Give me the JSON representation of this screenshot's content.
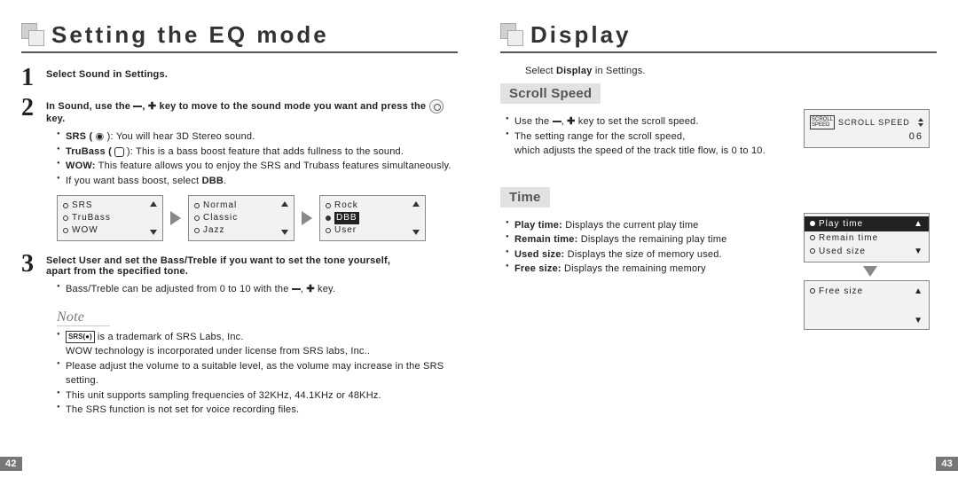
{
  "left": {
    "title": "Setting the EQ mode",
    "step1": "Select Sound in Settings.",
    "step2_a": "In Sound, use the ",
    "step2_b": " key to move to the sound mode you want and press the ",
    "step2_c": " key.",
    "bullets2": {
      "srs_label": "SRS ( ",
      "srs_text": " ): You will hear 3D Stereo sound.",
      "tru_label": "TruBass ( ",
      "tru_text": " ): This is a bass boost feature that adds fullness to the sound.",
      "wow_label": "WOW:",
      "wow_text": " This feature allows you to enjoy the SRS and Trubass features simultaneously.",
      "dbb": "If you want bass boost, select ",
      "dbb_b": "DBB"
    },
    "eq_box1": {
      "r1": "SRS",
      "r2": "TruBass",
      "r3": "WOW"
    },
    "eq_box2": {
      "r1": "Normal",
      "r2": "Classic",
      "r3": "Jazz"
    },
    "eq_box3": {
      "r1": "Rock",
      "r2": "DBB",
      "r3": "User"
    },
    "step3_a": "Select User and set the Bass/Treble if you want to set the tone yourself,",
    "step3_b": "apart from the specified tone.",
    "step3_bullet": "Bass/Treble can be adjusted from 0 to 10 with the ",
    "step3_bullet_end": " key.",
    "note_label": "Note",
    "notes": {
      "n1a": " is a trademark of SRS Labs, Inc.",
      "n1b": "WOW technology is incorporated under license from SRS labs, Inc..",
      "n2": "Please adjust the volume to a suitable level, as the volume may increase in the SRS setting.",
      "n3": "This unit supports sampling frequencies of 32KHz, 44.1KHz or 48KHz.",
      "n4": "The SRS function is not set for voice recording files."
    },
    "pagenum": "42"
  },
  "right": {
    "title": "Display",
    "intro_a": "Select ",
    "intro_b": "Display",
    "intro_c": " in Settings.",
    "scroll": {
      "heading": "Scroll Speed",
      "b1_a": "Use the ",
      "b1_b": " key to set the scroll speed.",
      "b2": "The setting range for the scroll speed,",
      "b2b": "which adjusts the speed of the track title flow, is 0 to 10.",
      "lcd_label": "SCROLL SPEED",
      "lcd_value": "06"
    },
    "time": {
      "heading": "Time",
      "b1_a": "Play time:",
      "b1_b": " Displays the current play time",
      "b2_a": "Remain time:",
      "b2_b": " Displays the remaining play time",
      "b3_a": "Used size:",
      "b3_b": " Displays the size of memory used.",
      "b4_a": "Free size:",
      "b4_b": " Displays the remaining memory",
      "lcd": {
        "r1": "Play time",
        "r2": "Remain time",
        "r3": "Used size",
        "r4": "Free size"
      }
    },
    "pagenum": "43"
  }
}
